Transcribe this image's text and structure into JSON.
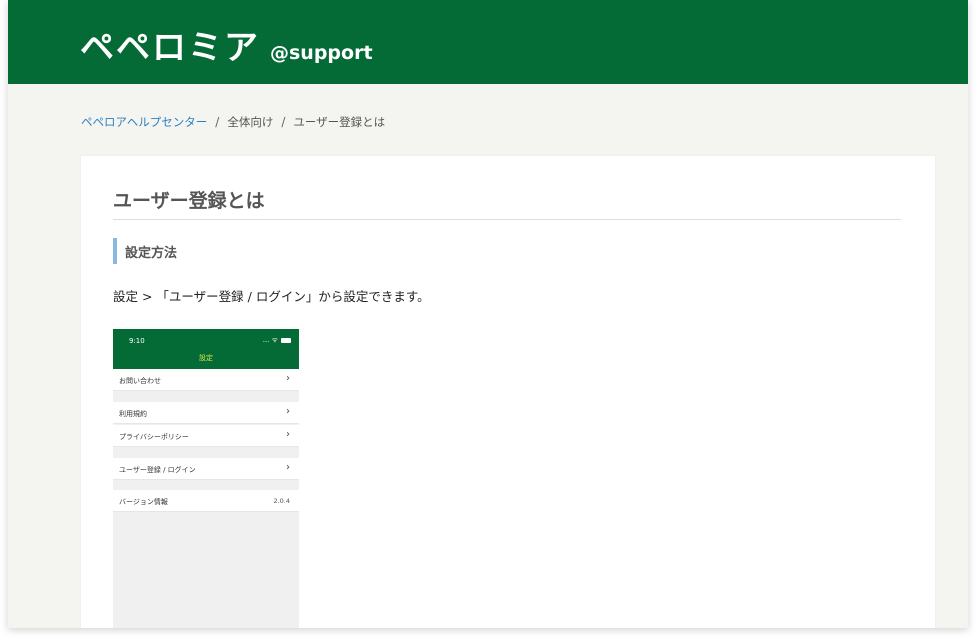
{
  "header": {
    "brand": "ペペロミア",
    "sub": "@support"
  },
  "breadcrumb": {
    "items": [
      "ペペロアヘルプセンター",
      "全体向け",
      "ユーザー登録とは"
    ],
    "separator": "/"
  },
  "article": {
    "title": "ユーザー登録とは",
    "section_heading": "設定方法",
    "body": "設定 > 「ユーザー登録 / ログイン」から設定できます。"
  },
  "phone": {
    "time": "9:10",
    "status": "... ᯤ",
    "title": "設定",
    "rows": [
      {
        "label": "お問い合わせ",
        "chevron": "›"
      },
      {
        "label": "利用規約",
        "chevron": "›"
      },
      {
        "label": "プライバシーポリシー",
        "chevron": "›"
      },
      {
        "label": "ユーザー登録 / ログイン",
        "chevron": "›"
      },
      {
        "label": "バージョン情報",
        "value": "2.0.4"
      }
    ]
  },
  "colors": {
    "brand_green": "#046b37",
    "link_blue": "#2d7fc1",
    "section_bar": "#8ab8e0",
    "page_bg": "#f4f5f0"
  }
}
